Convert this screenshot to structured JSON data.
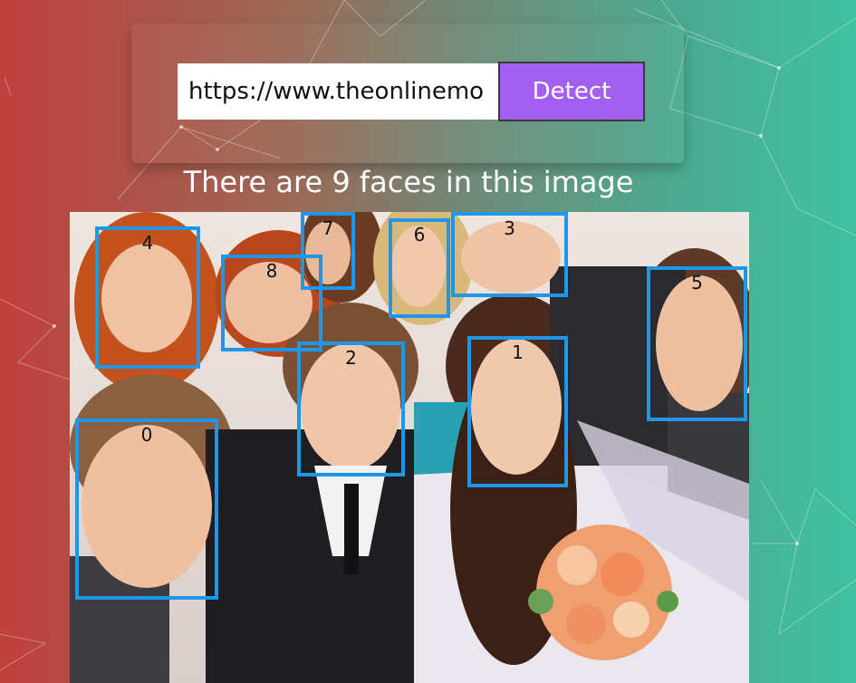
{
  "form": {
    "url_value": "https://www.theonlinemo",
    "detect_label": "Detect"
  },
  "result": {
    "message": "There are 9 faces in this image"
  },
  "faces": [
    {
      "label": "0"
    },
    {
      "label": "1"
    },
    {
      "label": "2"
    },
    {
      "label": "3"
    },
    {
      "label": "4"
    },
    {
      "label": "5"
    },
    {
      "label": "6"
    },
    {
      "label": "7"
    },
    {
      "label": "8"
    }
  ],
  "colors": {
    "accent_button": "#a25ff0",
    "box_border": "#1f97e6",
    "gradient_left": "#c13f3d",
    "gradient_right": "#3fc19f"
  }
}
